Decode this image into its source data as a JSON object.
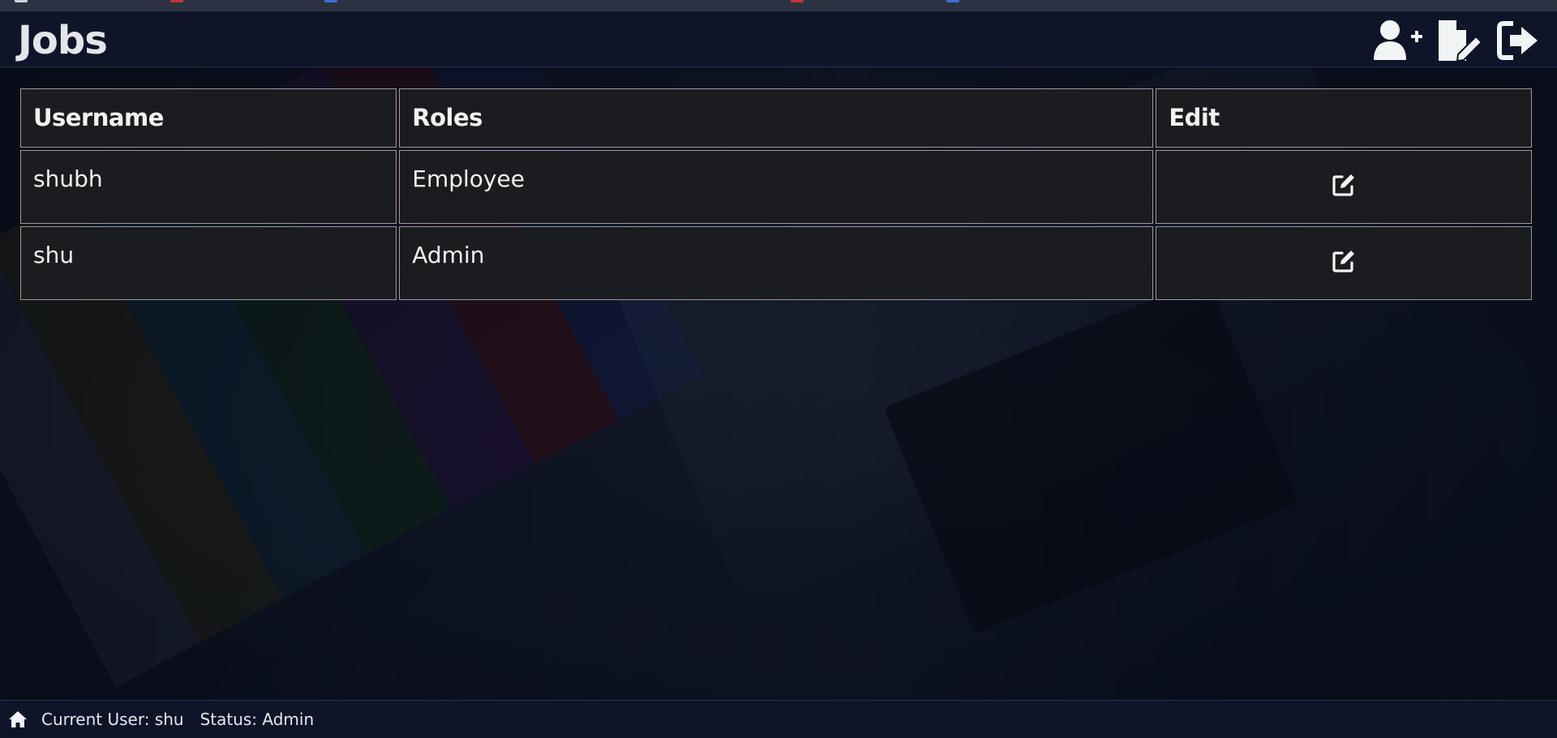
{
  "header": {
    "title": "Jobs",
    "actions": [
      {
        "icon": "user-plus-icon"
      },
      {
        "icon": "file-edit-icon"
      },
      {
        "icon": "sign-out-icon"
      }
    ]
  },
  "table": {
    "columns": [
      "Username",
      "Roles",
      "Edit"
    ],
    "rows": [
      {
        "username": "shubh",
        "role": "Employee",
        "edit_icon": "edit-icon"
      },
      {
        "username": "shu",
        "role": "Admin",
        "edit_icon": "edit-icon"
      }
    ]
  },
  "footer": {
    "home_icon": "home-icon",
    "current_user": "Current User: shu",
    "status": "Status: Admin"
  },
  "colors": {
    "header_bg": "#0f1528",
    "cell_bg": "#1b1c1f",
    "cell_border": "#9a9a9a",
    "text": "#f2f2f2"
  }
}
